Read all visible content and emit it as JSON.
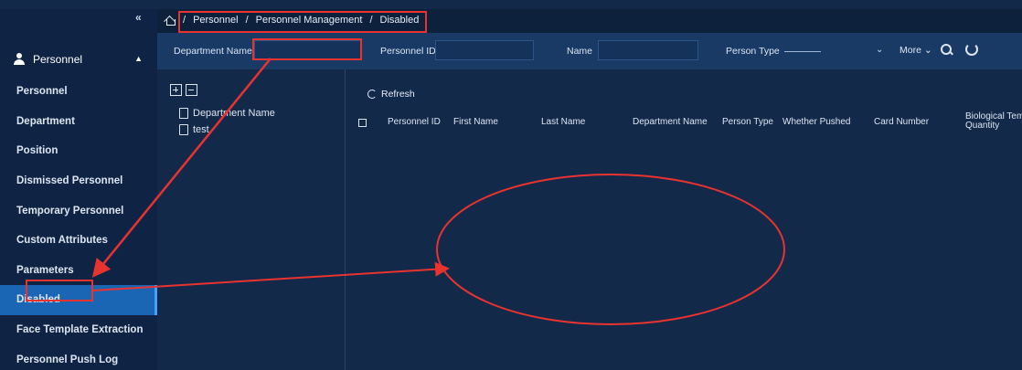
{
  "sidebar": {
    "collapse_glyph": "«",
    "group_label": "Personnel",
    "group_caret": "▲",
    "items": [
      {
        "label": "Personnel"
      },
      {
        "label": "Department"
      },
      {
        "label": "Position"
      },
      {
        "label": "Dismissed Personnel"
      },
      {
        "label": "Temporary Personnel"
      },
      {
        "label": "Custom Attributes"
      },
      {
        "label": "Parameters"
      },
      {
        "label": "Disabled",
        "active": true
      },
      {
        "label": "Face Template Extraction"
      },
      {
        "label": "Personnel Push Log"
      }
    ]
  },
  "breadcrumb": {
    "sep": "/",
    "items": [
      "Personnel",
      "Personnel Management",
      "Disabled"
    ]
  },
  "filters": {
    "department_name_label": "Department Name",
    "department_name_value": "",
    "personnel_id_label": "Personnel ID",
    "name_label": "Name",
    "person_type_label": "Person Type",
    "person_type_value": "",
    "more_label": "More",
    "chevron": "⌄"
  },
  "tree": {
    "items": [
      "Department Name",
      "test"
    ]
  },
  "main": {
    "refresh_label": "Refresh",
    "columns": [
      "Personnel ID",
      "First Name",
      "Last Name",
      "Department Name",
      "Person Type",
      "Whether Pushed",
      "Card Number",
      "Biological Template Quantity"
    ],
    "col_last_line1": "Biological Temp",
    "col_last_line2": "Quantity"
  },
  "annotation": {
    "color": "#e8332f"
  }
}
